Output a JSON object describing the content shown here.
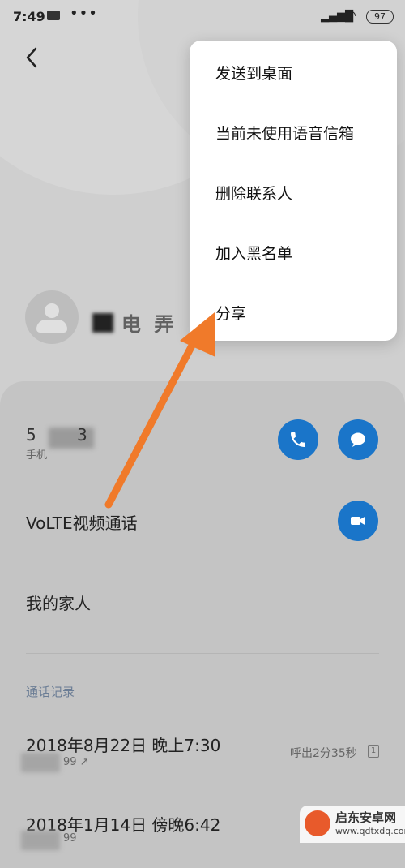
{
  "status_bar": {
    "time": "7:49",
    "dots": "•••",
    "signal": "▂▄▆█",
    "wifi": "◠",
    "battery": "97"
  },
  "menu": {
    "items": [
      "发送到桌面",
      "当前未使用语音信箱",
      "删除联系人",
      "加入黑名单",
      "分享"
    ]
  },
  "contact": {
    "name": "电 弄",
    "phone_prefix": "5",
    "phone_suffix": "3",
    "phone_type": "手机"
  },
  "rows": {
    "volte": "VoLTE视频通话",
    "family": "我的家人"
  },
  "call_log": {
    "title": "通话记录",
    "entries": [
      {
        "date": "2018年8月22日 晚上7:30",
        "number_tail": "99 ↗",
        "detail": "呼出2分35秒",
        "sim": "1"
      },
      {
        "date": "2018年1月14日 傍晚6:42",
        "number_tail": "99"
      }
    ]
  },
  "watermark": {
    "title": "启东安卓网",
    "url": "www.qdtxdq.com"
  },
  "colors": {
    "accent": "#1a75c9",
    "arrow": "#f07a2a"
  }
}
